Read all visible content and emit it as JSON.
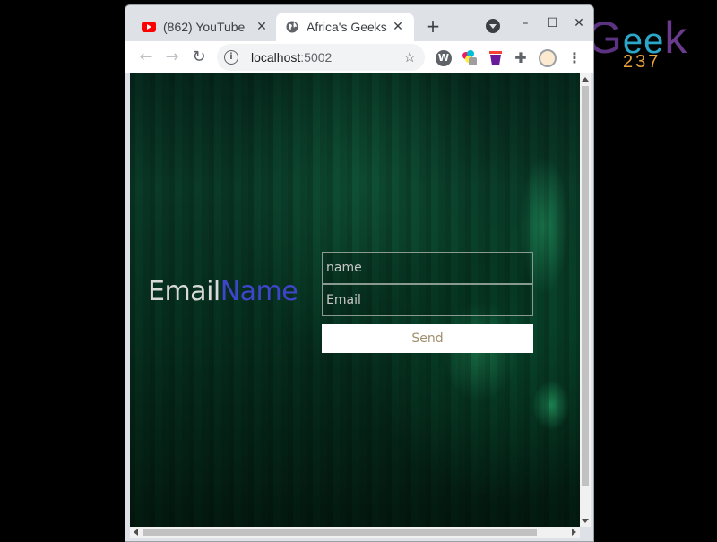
{
  "browser": {
    "tabs": [
      {
        "title": "(862) YouTube",
        "icon": "youtube-icon",
        "active": false
      },
      {
        "title": "Africa's Geeks",
        "icon": "globe-icon",
        "active": true
      }
    ],
    "new_tab_symbol": "+",
    "url_host": "localhost",
    "url_port": ":5002"
  },
  "page": {
    "brand_part1": "Email",
    "brand_part2": "Name",
    "name_placeholder": "name",
    "email_placeholder": "Email",
    "send_label": "Send"
  },
  "logo": {
    "text": "Geek",
    "number": "237"
  },
  "colors": {
    "brand_part2": "#3f45c9",
    "send_text": "#a0906f",
    "logo_purple": "#6a3a8c",
    "logo_blue": "#2aa7c9",
    "logo_orange": "#e8a33b"
  }
}
